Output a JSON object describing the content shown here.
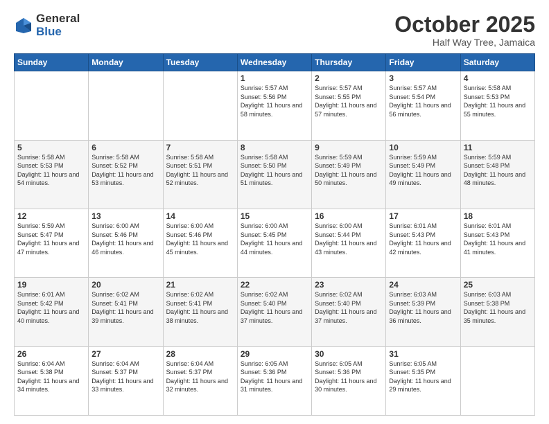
{
  "logo": {
    "general": "General",
    "blue": "Blue"
  },
  "header": {
    "month": "October 2025",
    "location": "Half Way Tree, Jamaica"
  },
  "weekdays": [
    "Sunday",
    "Monday",
    "Tuesday",
    "Wednesday",
    "Thursday",
    "Friday",
    "Saturday"
  ],
  "weeks": [
    [
      {
        "num": "",
        "sunrise": "",
        "sunset": "",
        "daylight": ""
      },
      {
        "num": "",
        "sunrise": "",
        "sunset": "",
        "daylight": ""
      },
      {
        "num": "",
        "sunrise": "",
        "sunset": "",
        "daylight": ""
      },
      {
        "num": "1",
        "sunrise": "Sunrise: 5:57 AM",
        "sunset": "Sunset: 5:56 PM",
        "daylight": "Daylight: 11 hours and 58 minutes."
      },
      {
        "num": "2",
        "sunrise": "Sunrise: 5:57 AM",
        "sunset": "Sunset: 5:55 PM",
        "daylight": "Daylight: 11 hours and 57 minutes."
      },
      {
        "num": "3",
        "sunrise": "Sunrise: 5:57 AM",
        "sunset": "Sunset: 5:54 PM",
        "daylight": "Daylight: 11 hours and 56 minutes."
      },
      {
        "num": "4",
        "sunrise": "Sunrise: 5:58 AM",
        "sunset": "Sunset: 5:53 PM",
        "daylight": "Daylight: 11 hours and 55 minutes."
      }
    ],
    [
      {
        "num": "5",
        "sunrise": "Sunrise: 5:58 AM",
        "sunset": "Sunset: 5:53 PM",
        "daylight": "Daylight: 11 hours and 54 minutes."
      },
      {
        "num": "6",
        "sunrise": "Sunrise: 5:58 AM",
        "sunset": "Sunset: 5:52 PM",
        "daylight": "Daylight: 11 hours and 53 minutes."
      },
      {
        "num": "7",
        "sunrise": "Sunrise: 5:58 AM",
        "sunset": "Sunset: 5:51 PM",
        "daylight": "Daylight: 11 hours and 52 minutes."
      },
      {
        "num": "8",
        "sunrise": "Sunrise: 5:58 AM",
        "sunset": "Sunset: 5:50 PM",
        "daylight": "Daylight: 11 hours and 51 minutes."
      },
      {
        "num": "9",
        "sunrise": "Sunrise: 5:59 AM",
        "sunset": "Sunset: 5:49 PM",
        "daylight": "Daylight: 11 hours and 50 minutes."
      },
      {
        "num": "10",
        "sunrise": "Sunrise: 5:59 AM",
        "sunset": "Sunset: 5:49 PM",
        "daylight": "Daylight: 11 hours and 49 minutes."
      },
      {
        "num": "11",
        "sunrise": "Sunrise: 5:59 AM",
        "sunset": "Sunset: 5:48 PM",
        "daylight": "Daylight: 11 hours and 48 minutes."
      }
    ],
    [
      {
        "num": "12",
        "sunrise": "Sunrise: 5:59 AM",
        "sunset": "Sunset: 5:47 PM",
        "daylight": "Daylight: 11 hours and 47 minutes."
      },
      {
        "num": "13",
        "sunrise": "Sunrise: 6:00 AM",
        "sunset": "Sunset: 5:46 PM",
        "daylight": "Daylight: 11 hours and 46 minutes."
      },
      {
        "num": "14",
        "sunrise": "Sunrise: 6:00 AM",
        "sunset": "Sunset: 5:46 PM",
        "daylight": "Daylight: 11 hours and 45 minutes."
      },
      {
        "num": "15",
        "sunrise": "Sunrise: 6:00 AM",
        "sunset": "Sunset: 5:45 PM",
        "daylight": "Daylight: 11 hours and 44 minutes."
      },
      {
        "num": "16",
        "sunrise": "Sunrise: 6:00 AM",
        "sunset": "Sunset: 5:44 PM",
        "daylight": "Daylight: 11 hours and 43 minutes."
      },
      {
        "num": "17",
        "sunrise": "Sunrise: 6:01 AM",
        "sunset": "Sunset: 5:43 PM",
        "daylight": "Daylight: 11 hours and 42 minutes."
      },
      {
        "num": "18",
        "sunrise": "Sunrise: 6:01 AM",
        "sunset": "Sunset: 5:43 PM",
        "daylight": "Daylight: 11 hours and 41 minutes."
      }
    ],
    [
      {
        "num": "19",
        "sunrise": "Sunrise: 6:01 AM",
        "sunset": "Sunset: 5:42 PM",
        "daylight": "Daylight: 11 hours and 40 minutes."
      },
      {
        "num": "20",
        "sunrise": "Sunrise: 6:02 AM",
        "sunset": "Sunset: 5:41 PM",
        "daylight": "Daylight: 11 hours and 39 minutes."
      },
      {
        "num": "21",
        "sunrise": "Sunrise: 6:02 AM",
        "sunset": "Sunset: 5:41 PM",
        "daylight": "Daylight: 11 hours and 38 minutes."
      },
      {
        "num": "22",
        "sunrise": "Sunrise: 6:02 AM",
        "sunset": "Sunset: 5:40 PM",
        "daylight": "Daylight: 11 hours and 37 minutes."
      },
      {
        "num": "23",
        "sunrise": "Sunrise: 6:02 AM",
        "sunset": "Sunset: 5:40 PM",
        "daylight": "Daylight: 11 hours and 37 minutes."
      },
      {
        "num": "24",
        "sunrise": "Sunrise: 6:03 AM",
        "sunset": "Sunset: 5:39 PM",
        "daylight": "Daylight: 11 hours and 36 minutes."
      },
      {
        "num": "25",
        "sunrise": "Sunrise: 6:03 AM",
        "sunset": "Sunset: 5:38 PM",
        "daylight": "Daylight: 11 hours and 35 minutes."
      }
    ],
    [
      {
        "num": "26",
        "sunrise": "Sunrise: 6:04 AM",
        "sunset": "Sunset: 5:38 PM",
        "daylight": "Daylight: 11 hours and 34 minutes."
      },
      {
        "num": "27",
        "sunrise": "Sunrise: 6:04 AM",
        "sunset": "Sunset: 5:37 PM",
        "daylight": "Daylight: 11 hours and 33 minutes."
      },
      {
        "num": "28",
        "sunrise": "Sunrise: 6:04 AM",
        "sunset": "Sunset: 5:37 PM",
        "daylight": "Daylight: 11 hours and 32 minutes."
      },
      {
        "num": "29",
        "sunrise": "Sunrise: 6:05 AM",
        "sunset": "Sunset: 5:36 PM",
        "daylight": "Daylight: 11 hours and 31 minutes."
      },
      {
        "num": "30",
        "sunrise": "Sunrise: 6:05 AM",
        "sunset": "Sunset: 5:36 PM",
        "daylight": "Daylight: 11 hours and 30 minutes."
      },
      {
        "num": "31",
        "sunrise": "Sunrise: 6:05 AM",
        "sunset": "Sunset: 5:35 PM",
        "daylight": "Daylight: 11 hours and 29 minutes."
      },
      {
        "num": "",
        "sunrise": "",
        "sunset": "",
        "daylight": ""
      }
    ]
  ]
}
